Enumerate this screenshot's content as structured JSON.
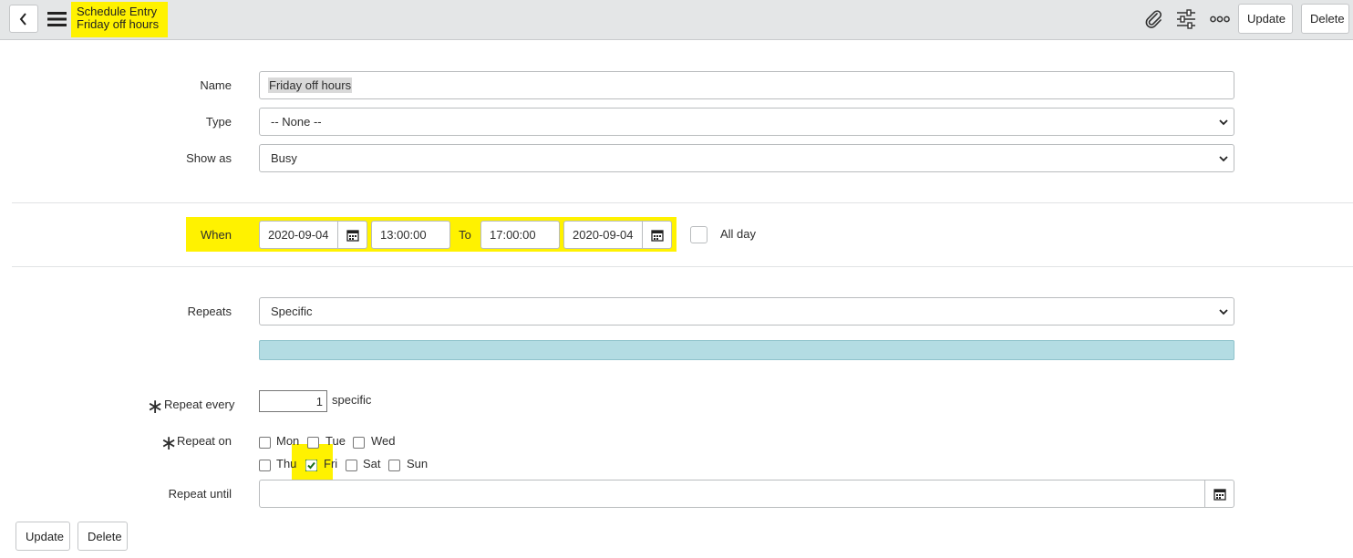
{
  "header": {
    "record_type": "Schedule Entry",
    "record_name": "Friday off hours",
    "update_label": "Update",
    "delete_label": "Delete"
  },
  "icons": {
    "back": "chevron-left-icon",
    "menu": "hamburger-menu-icon",
    "attachment": "paperclip-icon",
    "personalize": "sliders-icon",
    "more": "more-options-icon",
    "calendar": "calendar-icon"
  },
  "form": {
    "name": {
      "label": "Name",
      "value": "Friday off hours"
    },
    "type": {
      "label": "Type",
      "value": "-- None --"
    },
    "show_as": {
      "label": "Show as",
      "value": "Busy"
    },
    "when": {
      "label": "When",
      "start_date": "2020-09-04",
      "start_time": "13:00:00",
      "to_label": "To",
      "end_time": "17:00:00",
      "end_date": "2020-09-04",
      "all_day_label": "All day",
      "all_day_checked": false
    },
    "repeats": {
      "label": "Repeats",
      "value": "Specific"
    },
    "repeat_every": {
      "label": "Repeat every",
      "value": "1",
      "unit": "specific"
    },
    "repeat_on": {
      "label": "Repeat on",
      "days": [
        {
          "label": "Mon",
          "checked": false
        },
        {
          "label": "Tue",
          "checked": false
        },
        {
          "label": "Wed",
          "checked": false
        },
        {
          "label": "Thu",
          "checked": false
        },
        {
          "label": "Fri",
          "checked": true
        },
        {
          "label": "Sat",
          "checked": false
        },
        {
          "label": "Sun",
          "checked": false
        }
      ]
    },
    "repeat_until": {
      "label": "Repeat until",
      "value": ""
    }
  },
  "footer": {
    "update_label": "Update",
    "delete_label": "Delete"
  },
  "colors": {
    "highlight": "#fff200",
    "info_bar": "#b3dce3",
    "check": "#1a6d1a"
  }
}
